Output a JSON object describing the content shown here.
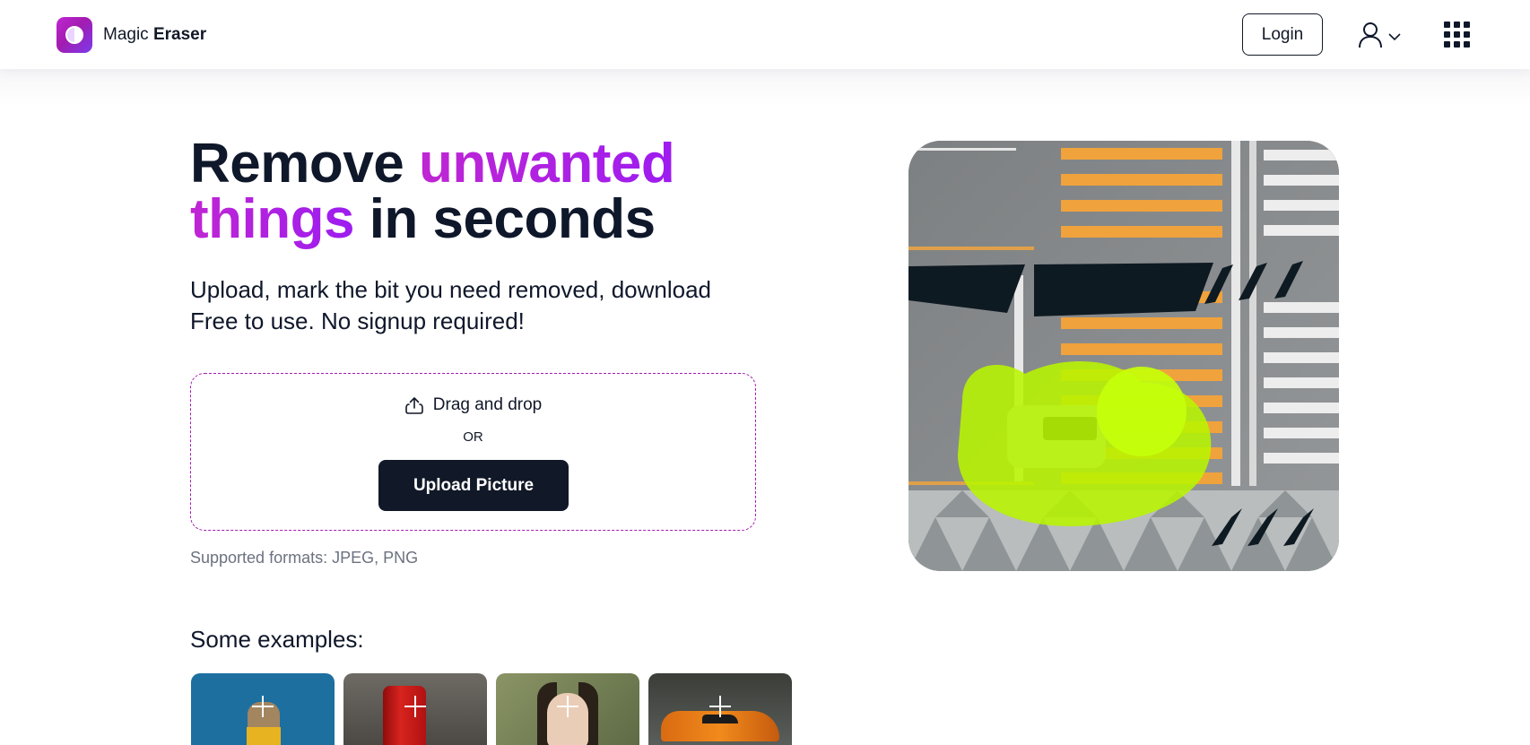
{
  "header": {
    "logo_text_regular": "Magic",
    "logo_text_bold": "Eraser",
    "login_label": "Login"
  },
  "hero": {
    "headline_part1": "Remove ",
    "headline_accent1": "unwanted",
    "headline_accent2": "things",
    "headline_part2": " in seconds",
    "subtitle_line1": "Upload, mark the bit you need removed, download",
    "subtitle_line2": "Free to use. No signup required!"
  },
  "upload": {
    "drag_label": "Drag and drop",
    "or_label": "OR",
    "button_label": "Upload Picture",
    "formats_note": "Supported formats: JPEG, PNG"
  },
  "examples": {
    "title": "Some examples:",
    "items": [
      {
        "subject": "dog"
      },
      {
        "subject": "cola-can"
      },
      {
        "subject": "woman"
      },
      {
        "subject": "sports-car"
      }
    ]
  },
  "icons": {
    "logo": "magic-eraser-logo-icon",
    "user": "user-icon",
    "chevron": "chevron-down-icon",
    "apps": "apps-grid-icon",
    "upload": "upload-icon",
    "plus": "plus-icon"
  },
  "colors": {
    "accent_start": "#c026d3",
    "accent_end": "#9d1cf0",
    "primary_dark": "#111827",
    "highlight_mask": "#b8f500"
  }
}
